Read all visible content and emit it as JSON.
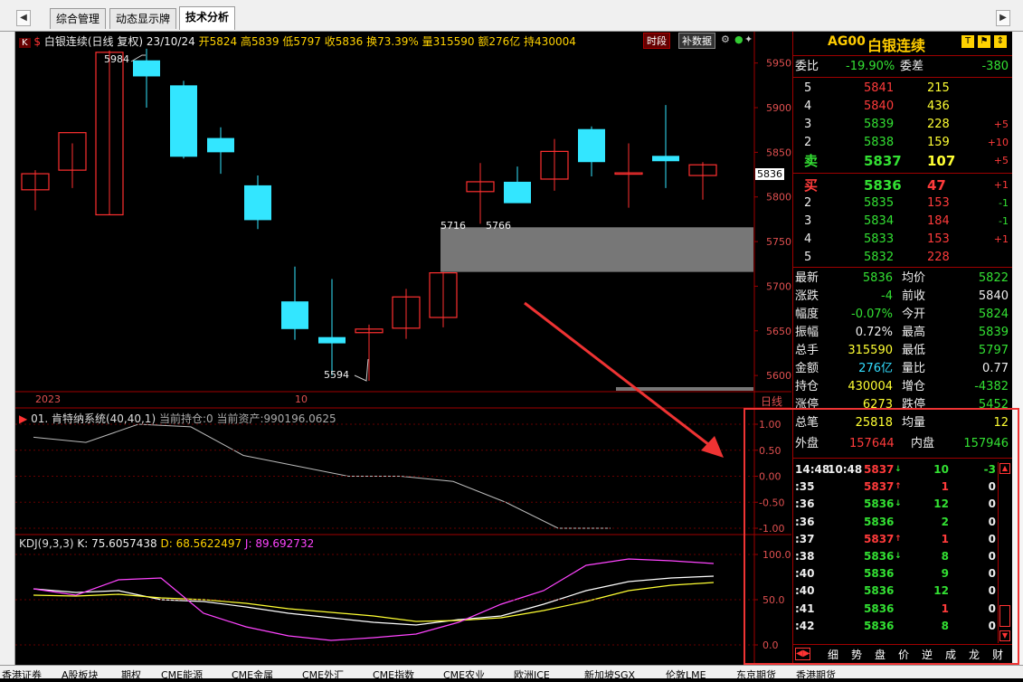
{
  "tabs": [
    {
      "label": "综合管理"
    },
    {
      "label": "动态显示牌"
    },
    {
      "label": "技术分析"
    }
  ],
  "chart_header": {
    "k_badge": "K",
    "s_badge": "$",
    "title": "白银连续(日线 复权) 23/10/24",
    "open": "开5824",
    "high": "高5839",
    "low": "低5797",
    "close": "收5836",
    "turnover": "换73.39%",
    "volume": "量315590",
    "amount": "额276亿",
    "position": "持430004",
    "btn_timeshare": "时段",
    "btn_supplement": "补数据"
  },
  "price_axis": [
    "5950",
    "5900",
    "5850",
    "5800",
    "5750",
    "5700",
    "5650",
    "5600"
  ],
  "current_price_tag": "5836",
  "date_labels": {
    "year": "2023",
    "month": "10",
    "period": "日线"
  },
  "annotations": {
    "high": "5984",
    "low": "5594",
    "gap_left": "5716",
    "gap_right": "5766"
  },
  "indicator1": {
    "label": "01. 肯特纳系统(40,40,1)",
    "holding": "当前持仓:0",
    "assets": "当前资产:990196.0625",
    "axis": [
      "1.00",
      "0.50",
      "0.00",
      "-0.50",
      "-1.00"
    ]
  },
  "kdj": {
    "label": "KDJ(9,3,3)",
    "k": "K: 75.6057438",
    "d": "D: 68.5622497",
    "j": "J: 89.692732",
    "axis": [
      "100.0",
      "50.0",
      "0.0"
    ]
  },
  "chart_data": {
    "type": "candlestick",
    "candles": [
      {
        "o": 5808,
        "h": 5830,
        "l": 5785,
        "c": 5826
      },
      {
        "o": 5830,
        "h": 5860,
        "l": 5810,
        "c": 5872
      },
      {
        "o": 5780,
        "h": 5964,
        "l": 5780,
        "c": 5962
      },
      {
        "o": 5953,
        "h": 5966,
        "l": 5900,
        "c": 5935
      },
      {
        "o": 5925,
        "h": 5930,
        "l": 5843,
        "c": 5845
      },
      {
        "o": 5866,
        "h": 5878,
        "l": 5826,
        "c": 5850
      },
      {
        "o": 5813,
        "h": 5824,
        "l": 5764,
        "c": 5774
      },
      {
        "o": 5683,
        "h": 5722,
        "l": 5640,
        "c": 5652
      },
      {
        "o": 5643,
        "h": 5708,
        "l": 5600,
        "c": 5636
      },
      {
        "o": 5648,
        "h": 5657,
        "l": 5594,
        "c": 5652
      },
      {
        "o": 5653,
        "h": 5697,
        "l": 5641,
        "c": 5688
      },
      {
        "o": 5665,
        "h": 5716,
        "l": 5654,
        "c": 5715
      },
      {
        "o": 5806,
        "h": 5838,
        "l": 5770,
        "c": 5817
      },
      {
        "o": 5817,
        "h": 5834,
        "l": 5794,
        "c": 5793
      },
      {
        "o": 5820,
        "h": 5865,
        "l": 5807,
        "c": 5851
      },
      {
        "o": 5876,
        "h": 5879,
        "l": 5823,
        "c": 5839
      },
      {
        "o": 5827,
        "h": 5860,
        "l": 5788,
        "c": 5827
      },
      {
        "o": 5846,
        "h": 5903,
        "l": 5810,
        "c": 5840
      },
      {
        "o": 5824,
        "h": 5839,
        "l": 5797,
        "c": 5836
      }
    ],
    "ylim": [
      5590,
      5975
    ],
    "gap_zone": [
      5716,
      5766
    ],
    "indicator_line": [
      0.75,
      0.65,
      1.0,
      0.95,
      0.4,
      0.2,
      0.0,
      0.0,
      -0.1,
      -0.5,
      -1.0,
      -1.0
    ],
    "kdj_k": [
      62,
      58,
      60,
      50,
      48,
      42,
      35,
      30,
      25,
      22,
      28,
      32,
      45,
      60,
      70,
      74,
      76
    ],
    "kdj_d": [
      55,
      54,
      56,
      52,
      50,
      46,
      40,
      36,
      32,
      26,
      27,
      30,
      38,
      48,
      60,
      66,
      69
    ],
    "kdj_j": [
      62,
      55,
      72,
      74,
      35,
      20,
      10,
      5,
      8,
      12,
      25,
      45,
      60,
      88,
      95,
      93,
      90
    ]
  },
  "quote": {
    "code": "AG00",
    "name": "白银连续",
    "weibi_label": "委比",
    "weibi": "-19.90%",
    "weicha_label": "委差",
    "weicha": "-380",
    "asks": [
      {
        "lvl": "5",
        "price": "5841",
        "vol": "215",
        "chg": ""
      },
      {
        "lvl": "4",
        "price": "5840",
        "vol": "436",
        "chg": ""
      },
      {
        "lvl": "3",
        "price": "5839",
        "vol": "228",
        "chg": "+5"
      },
      {
        "lvl": "2",
        "price": "5838",
        "vol": "159",
        "chg": "+10"
      },
      {
        "lvl": "卖",
        "price": "5837",
        "vol": "107",
        "chg": "+5"
      }
    ],
    "bids": [
      {
        "lvl": "买",
        "price": "5836",
        "vol": "47",
        "chg": "+1"
      },
      {
        "lvl": "2",
        "price": "5835",
        "vol": "153",
        "chg": "-1"
      },
      {
        "lvl": "3",
        "price": "5834",
        "vol": "184",
        "chg": "-1"
      },
      {
        "lvl": "4",
        "price": "5833",
        "vol": "153",
        "chg": "+1"
      },
      {
        "lvl": "5",
        "price": "5832",
        "vol": "228",
        "chg": ""
      }
    ],
    "stats": [
      {
        "l1": "最新",
        "v1": "5836",
        "l2": "均价",
        "v2": "5822"
      },
      {
        "l1": "涨跌",
        "v1": "-4",
        "l2": "前收",
        "v2": "5840"
      },
      {
        "l1": "幅度",
        "v1": "-0.07%",
        "l2": "今开",
        "v2": "5824"
      },
      {
        "l1": "振幅",
        "v1": "0.72%",
        "l2": "最高",
        "v2": "5839"
      },
      {
        "l1": "总手",
        "v1": "315590",
        "l2": "最低",
        "v2": "5797"
      },
      {
        "l1": "金额",
        "v1": "276亿",
        "l2": "量比",
        "v2": "0.77"
      },
      {
        "l1": "持仓",
        "v1": "430004",
        "l2": "增仓",
        "v2": "-4382"
      },
      {
        "l1": "涨停",
        "v1": "6273",
        "l2": "跌停",
        "v2": "5452"
      },
      {
        "l1": "总笔",
        "v1": "25818",
        "l2": "均量",
        "v2": "12"
      }
    ],
    "outer_label": "外盘",
    "outer": "157644",
    "inner_label": "内盘",
    "inner": "157946",
    "ticks": [
      {
        "t": "14:48",
        "t2": "10:48",
        "p": "5837",
        "arrow": "↓",
        "v": "10",
        "d": "-3"
      },
      {
        "t": ":35",
        "t2": "",
        "p": "5837",
        "arrow": "↑",
        "v": "1",
        "d": "0"
      },
      {
        "t": ":36",
        "t2": "",
        "p": "5836",
        "arrow": "↓",
        "v": "12",
        "d": "0"
      },
      {
        "t": ":36",
        "t2": "",
        "p": "5836",
        "arrow": "",
        "v": "2",
        "d": "0"
      },
      {
        "t": ":37",
        "t2": "",
        "p": "5837",
        "arrow": "↑",
        "v": "1",
        "d": "0"
      },
      {
        "t": ":38",
        "t2": "",
        "p": "5836",
        "arrow": "↓",
        "v": "8",
        "d": "0"
      },
      {
        "t": ":40",
        "t2": "",
        "p": "5836",
        "arrow": "",
        "v": "9",
        "d": "0"
      },
      {
        "t": ":40",
        "t2": "",
        "p": "5836",
        "arrow": "",
        "v": "12",
        "d": "0"
      },
      {
        "t": ":41",
        "t2": "",
        "p": "5836",
        "arrow": "",
        "v": "1",
        "d": "0"
      },
      {
        "t": ":42",
        "t2": "",
        "p": "5836",
        "arrow": "",
        "v": "8",
        "d": "0"
      }
    ],
    "bottom_tabs": [
      "细",
      "势",
      "盘",
      "价",
      "逆",
      "成",
      "龙",
      "财"
    ]
  },
  "bottom_bar": [
    "香港证券",
    "A股板块",
    "期权",
    "CME能源",
    "CME金属",
    "CME外汇",
    "CME指数",
    "CME农业",
    "欧洲ICE",
    "新加坡SGX",
    "伦敦LME",
    "东京期货",
    "香港期货"
  ]
}
